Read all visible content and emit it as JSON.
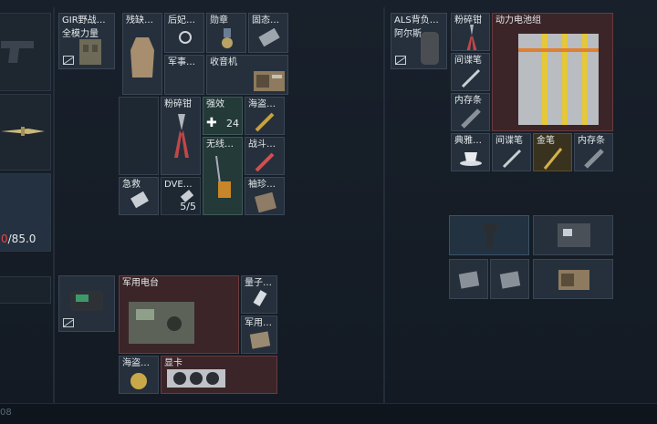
{
  "left_column": {
    "health_value_red": "0",
    "health_value_rest": "/85.0"
  },
  "equip_slots": {
    "rig_label": "GIR野战…",
    "rig_sub": "全模力量",
    "backpack_label": "ALS背负…",
    "backpack_sub": "阿尔斯"
  },
  "chest_rig": {
    "cells": [
      {
        "label": "残缺…"
      },
      {
        "label": "后妃…"
      },
      {
        "label": "军事…"
      },
      {
        "label": "勋章"
      },
      {
        "label": "固态…"
      },
      {
        "label": "收音机"
      }
    ]
  },
  "pockets": {
    "cells": [
      {
        "label": "急救"
      },
      {
        "label": "粉碎钳"
      },
      {
        "label": "DVE…",
        "count": "5/5"
      },
      {
        "label": "强效",
        "count": "24"
      },
      {
        "label": "无线…"
      },
      {
        "label": "海盗…"
      },
      {
        "label": "战斗…"
      },
      {
        "label": "袖珍…"
      }
    ]
  },
  "backpack": {
    "cells": [
      {
        "label": "粉碎钳"
      },
      {
        "label": "动力电池组"
      },
      {
        "label": "间谍笔"
      },
      {
        "label": "内存条"
      },
      {
        "label": "典雅…"
      },
      {
        "label": "间谍笔"
      },
      {
        "label": "金笔"
      },
      {
        "label": "内存条"
      }
    ]
  },
  "backpack_extra": {
    "items": [
      "grip",
      "circuit-board",
      "cpu",
      "cpu",
      "radio"
    ]
  },
  "radio_container": {
    "cells": [
      {
        "label": "军用电台"
      },
      {
        "label": "量子…"
      },
      {
        "label": "军用…"
      },
      {
        "label": "海盗…"
      },
      {
        "label": "显卡"
      }
    ]
  },
  "footer": {
    "text": "08"
  }
}
